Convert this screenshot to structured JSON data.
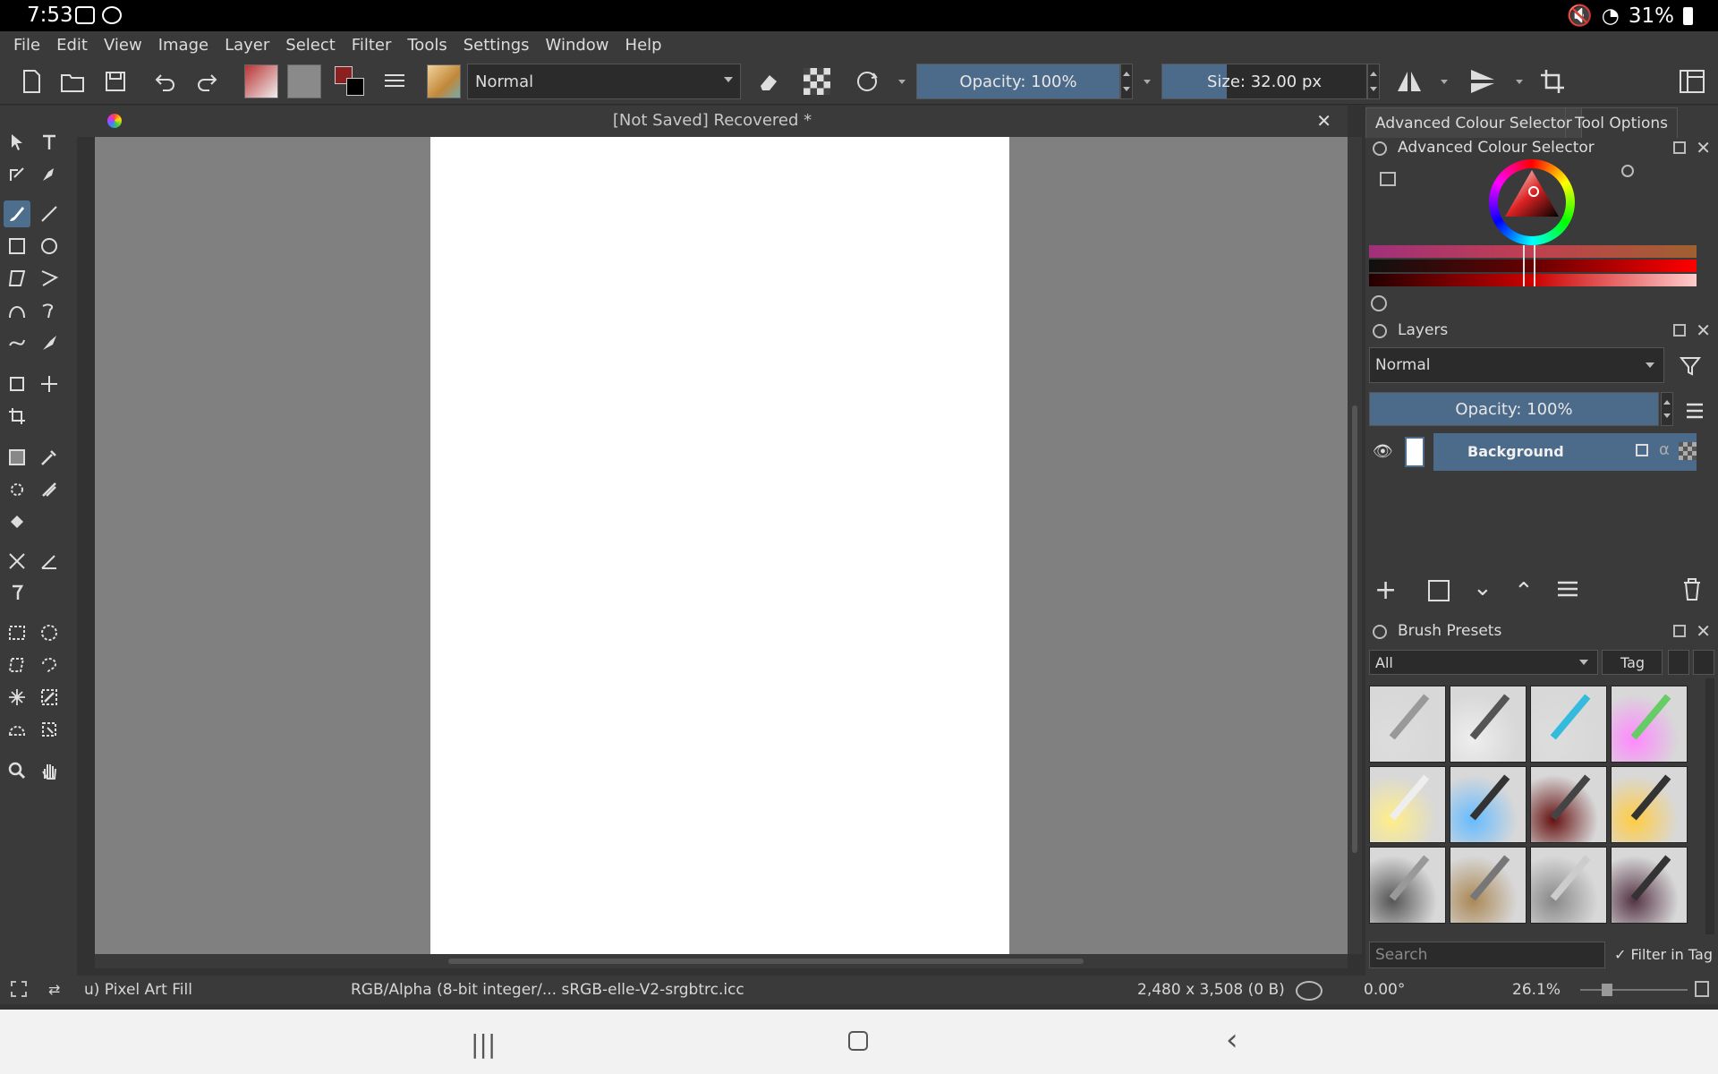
{
  "status_bar": {
    "time": "7:53",
    "battery": "31%"
  },
  "menu": [
    "File",
    "Edit",
    "View",
    "Image",
    "Layer",
    "Select",
    "Filter",
    "Tools",
    "Settings",
    "Window",
    "Help"
  ],
  "toolbar": {
    "blend_mode": "Normal",
    "opacity_label": "Opacity: 100%",
    "opacity_value": 1.0,
    "size_label": "Size: 32.00 px"
  },
  "document": {
    "title": "[Not Saved]  Recovered  *"
  },
  "docker_tabs": [
    "Advanced Colour Selector",
    "Tool Options"
  ],
  "colour_selector": {
    "title": "Advanced Colour Selector"
  },
  "layers": {
    "title": "Layers",
    "blend_mode": "Normal",
    "opacity_label": "Opacity:  100%",
    "items": [
      {
        "name": "Background"
      }
    ]
  },
  "brush_presets": {
    "title": "Brush Presets",
    "filter": "All",
    "tag_label": "Tag",
    "search_placeholder": "Search",
    "filter_in_tag": "Filter in Tag"
  },
  "footer": {
    "tool": "u) Pixel Art Fill",
    "color_profile": "RGB/Alpha (8-bit integer/... sRGB-elle-V2-srgbtrc.icc",
    "dimensions": "2,480 x 3,508 (0 B)",
    "rotation": "0.00°",
    "zoom": "26.1%"
  },
  "colors": {
    "accent": "#4c6b8a",
    "panel": "#3a3a3a",
    "canvas_bg": "#808080"
  }
}
